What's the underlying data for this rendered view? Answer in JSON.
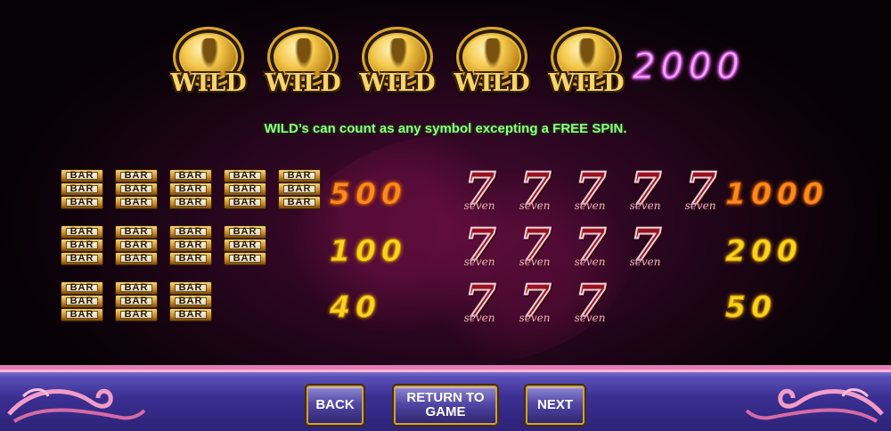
{
  "wild": {
    "symbol_label": "WILD",
    "count": 5,
    "payout": "2000"
  },
  "rule_text": "WILD’s can count as any symbol excepting a FREE SPIN.",
  "bar_symbol_label": "BAR",
  "seven_symbol": {
    "digit": "7",
    "word": "seven"
  },
  "bar_payouts": [
    {
      "count": 5,
      "payout": "500"
    },
    {
      "count": 4,
      "payout": "100"
    },
    {
      "count": 3,
      "payout": "40"
    }
  ],
  "seven_payouts": [
    {
      "count": 5,
      "payout": "1000"
    },
    {
      "count": 4,
      "payout": "200"
    },
    {
      "count": 3,
      "payout": "50"
    }
  ],
  "buttons": {
    "back": "BACK",
    "return_line1": "RETURN TO",
    "return_line2": "GAME",
    "next": "NEXT"
  },
  "colors": {
    "wild_payout": "#f4a8ff",
    "rule_text": "#8dff7f",
    "payout_top": "#ff8a1e",
    "payout_other": "#ffd21e",
    "bottom_bar": "#3b2f92"
  }
}
